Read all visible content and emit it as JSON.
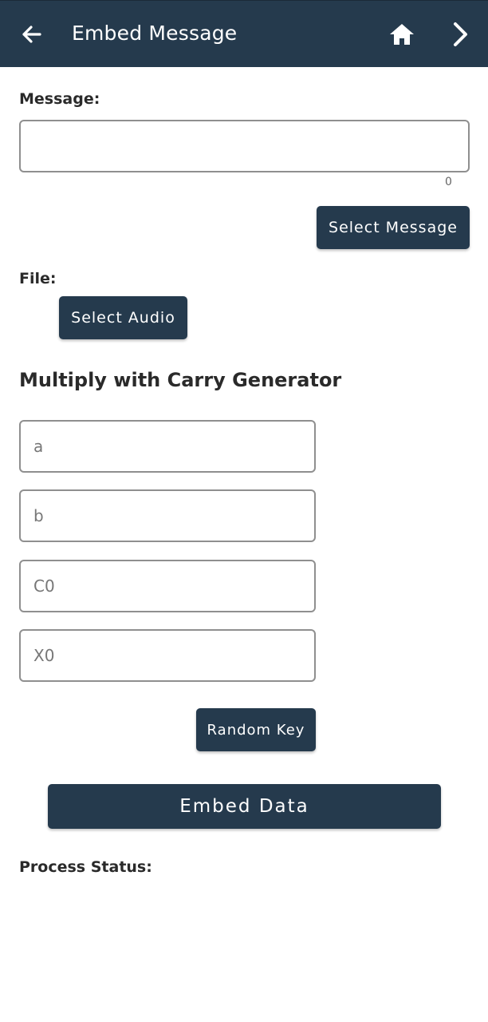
{
  "appbar": {
    "title": "Embed Message",
    "back_icon": "arrow-left-icon",
    "home_icon": "home-icon",
    "next_icon": "chevron-right-icon",
    "color": "#253a4d"
  },
  "message": {
    "label": "Message:",
    "value": "",
    "char_count": "0",
    "select_button": "Select Message"
  },
  "file": {
    "label": "File:",
    "select_button": "Select Audio"
  },
  "generator": {
    "title": "Multiply with Carry Generator",
    "fields": [
      {
        "placeholder": "a",
        "value": ""
      },
      {
        "placeholder": "b",
        "value": ""
      },
      {
        "placeholder": "C0",
        "value": ""
      },
      {
        "placeholder": "X0",
        "value": ""
      }
    ],
    "random_button": "Random Key"
  },
  "embed_button": "Embed Data",
  "status": {
    "label": "Process Status:",
    "text": ""
  }
}
